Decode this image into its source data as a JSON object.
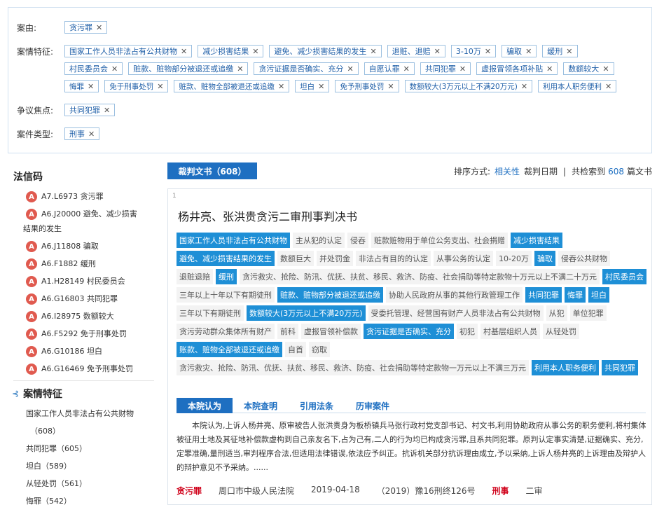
{
  "filters": {
    "anyou_label": "案由:",
    "anyou": [
      "贪污罪"
    ],
    "tezheng_label": "案情特征:",
    "tezheng_row1": [
      "国家工作人员非法占有公共财物",
      "减少损害结果",
      "避免、减少损害结果的发生",
      "退赃、退赔",
      "3-10万",
      "骗取",
      "缓刑"
    ],
    "tezheng_row2": [
      "村民委员会",
      "赃款、赃物部分被退还或追缴",
      "贪污证据是否确实、充分",
      "自愿认罪",
      "共同犯罪",
      "虚报冒领各项补贴",
      "数额较大"
    ],
    "tezheng_row3": [
      "悔罪",
      "免于刑事处罚",
      "赃款、赃物全部被退还或追缴",
      "坦白",
      "免予刑事处罚",
      "数额较大(3万元以上不满20万元)",
      "利用本人职务便利"
    ],
    "zhengyi_label": "争议焦点:",
    "zhengyi": [
      "共同犯罪"
    ],
    "leixing_label": "案件类型:",
    "leixing": [
      "刑事"
    ],
    "close_glyph": "✕"
  },
  "sidebar": {
    "fxm_title": "法信码",
    "fxm_items": [
      {
        "code": "A7.L6973 贪污罪"
      },
      {
        "code": "A6.J20000 避免、减少损害"
      },
      {
        "code": "A6.J11808 骗取"
      },
      {
        "code": "A6.F1882 缓刑"
      },
      {
        "code": "A1.H28149 村民委员会"
      },
      {
        "code": "A6.G16803 共同犯罪"
      },
      {
        "code": "A6.I28975 数额较大"
      },
      {
        "code": "A6.F5292 免于刑事处罚"
      },
      {
        "code": "A6.G10186 坦白"
      },
      {
        "code": "A6.G16469 免予刑事处罚"
      }
    ],
    "fxm_wrap_text": "结果的发生",
    "feat_title": "案情特征",
    "feat_items": [
      "国家工作人员非法占有公共财物",
      "（608）",
      "共同犯罪（605）",
      "坦白（589）",
      "从轻处罚（561）",
      "悔罪（542）"
    ]
  },
  "main": {
    "tab_label": "裁判文书（608）",
    "sort_label": "排序方式:",
    "sort_relevance": "相关性",
    "sort_date": "裁判日期",
    "sep": "|",
    "total_prefix": "共检索到",
    "total_count": "608",
    "total_suffix": "篇文书"
  },
  "card": {
    "index": "1",
    "title": "杨井亮、张洪贵贪污二审刑事判决书",
    "tag_rows": [
      [
        {
          "t": "国家工作人员非法占有公共财物",
          "h": true
        },
        {
          "t": "主从犯的认定",
          "h": false
        },
        {
          "t": "侵吞",
          "h": false
        },
        {
          "t": "赃款赃物用于单位公务支出、社会捐赠",
          "h": false
        },
        {
          "t": "减少损害结果",
          "h": true
        }
      ],
      [
        {
          "t": "避免、减少损害结果的发生",
          "h": true
        },
        {
          "t": "数额巨大",
          "h": false
        },
        {
          "t": "并处罚金",
          "h": false
        },
        {
          "t": "非法占有目的的认定",
          "h": false
        },
        {
          "t": "从事公务的认定",
          "h": false
        },
        {
          "t": "10-20万",
          "h": false
        },
        {
          "t": "骗取",
          "h": true
        },
        {
          "t": "侵吞公共财物",
          "h": false
        }
      ],
      [
        {
          "t": "退赃退赔",
          "h": false
        },
        {
          "t": "缓刑",
          "h": true
        },
        {
          "t": "贪污救灾、抢险、防汛、优抚、扶贫、移民、救济、防疫、社会捐助等特定款物十万元以上不满二十万元",
          "h": false
        },
        {
          "t": "村民委员会",
          "h": true
        }
      ],
      [
        {
          "t": "三年以上十年以下有期徒刑",
          "h": false
        },
        {
          "t": "赃款、赃物部分被退还或追缴",
          "h": true
        },
        {
          "t": "协助人民政府从事的其他行政管理工作",
          "h": false
        },
        {
          "t": "共同犯罪",
          "h": true
        },
        {
          "t": "悔罪",
          "h": true
        },
        {
          "t": "坦白",
          "h": true
        }
      ],
      [
        {
          "t": "三年以下有期徒刑",
          "h": false
        },
        {
          "t": "数额较大(3万元以上不满20万元)",
          "h": true
        },
        {
          "t": "受委托管理、经营国有财产人员非法占有公共财物",
          "h": false
        },
        {
          "t": "从犯",
          "h": false
        },
        {
          "t": "单位犯罪",
          "h": false
        }
      ],
      [
        {
          "t": "贪污劳动群众集体所有财产",
          "h": false
        },
        {
          "t": "前科",
          "h": false
        },
        {
          "t": "虚报冒领补偿款",
          "h": false
        },
        {
          "t": "贪污证据是否确实、充分",
          "h": true
        },
        {
          "t": "初犯",
          "h": false
        },
        {
          "t": "村基层组织人员",
          "h": false
        },
        {
          "t": "从轻处罚",
          "h": false
        }
      ],
      [
        {
          "t": "账款、赃物全部被退还或追缴",
          "h": true
        },
        {
          "t": "自首",
          "h": false
        },
        {
          "t": "窃取",
          "h": false
        }
      ],
      [
        {
          "t": "贪污救灾、抢险、防汛、优抚、扶贫、移民、救济、防疫、社会捐助等特定款物一万元以上不满三万元",
          "h": false
        },
        {
          "t": "利用本人职务便利",
          "h": true
        },
        {
          "t": "共同犯罪",
          "h": true
        }
      ]
    ],
    "subtabs": [
      "本院认为",
      "本院查明",
      "引用法条",
      "历审案件"
    ],
    "summary": "本院认为,上诉人杨井亮、原审被告人张洪贵身为板桥镇兵马张行政村党支部书记、村文书,利用协助政府从事公务的职务便利,将村集体被征用土地及其征地补偿款虚构到自己亲友名下,占为己有,二人的行为均已构成贪污罪,且系共同犯罪。原判认定事实清楚,证据确实、充分,定罪准确,量刑适当,审判程序合法,但适用法律错误,依法应予纠正。抗诉机关部分抗诉理由成立,予以采纳,上诉人杨井亮的上诉理由及辩护人的辩护意见不予采纳。......",
    "meta": {
      "cause": "贪污罪",
      "court": "周口市中级人民法院",
      "date": "2019-04-18",
      "case_no": "（2019）豫16刑终126号",
      "type": "刑事",
      "stage": "二审"
    }
  }
}
